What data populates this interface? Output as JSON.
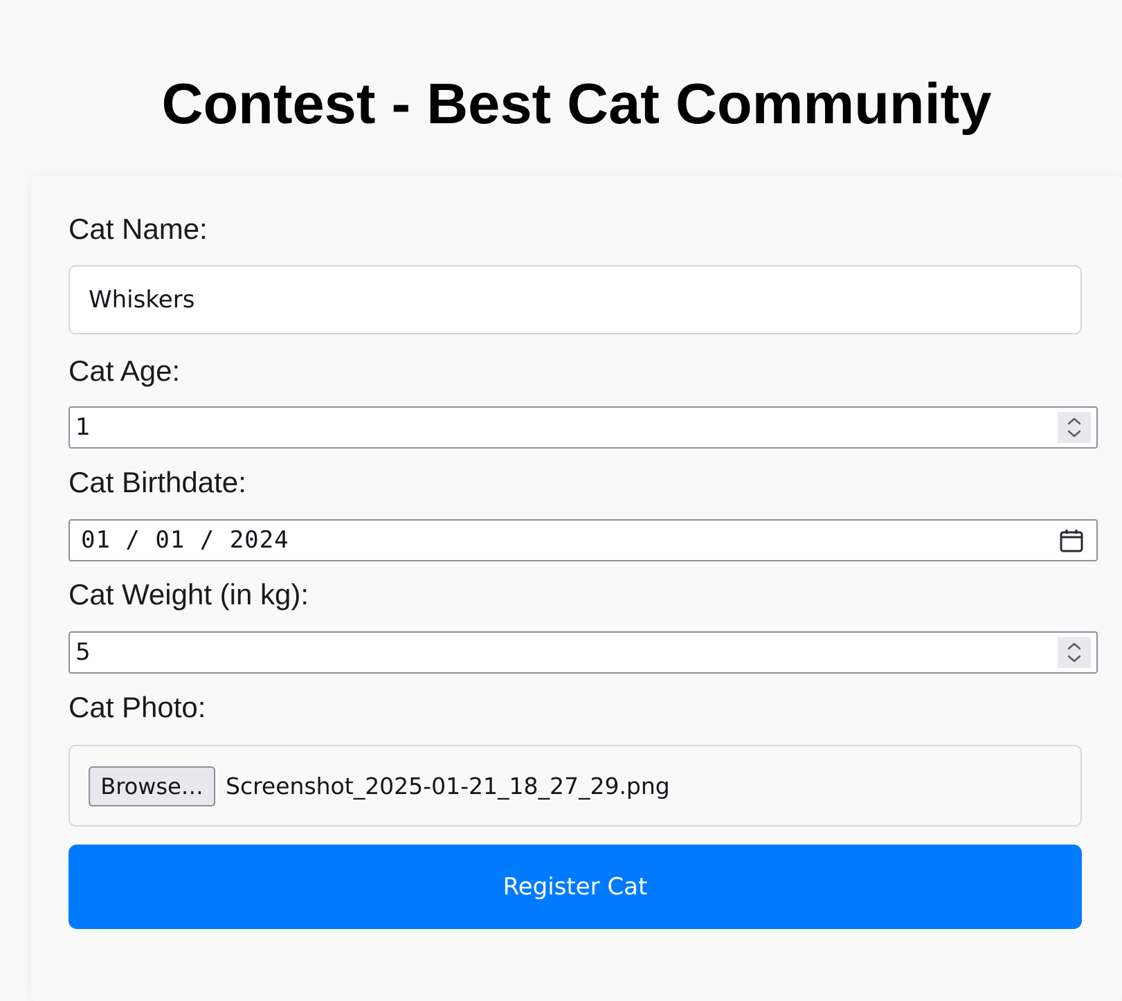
{
  "page": {
    "title": "Contest - Best Cat Community"
  },
  "form": {
    "name": {
      "label": "Cat Name:",
      "value": "Whiskers"
    },
    "age": {
      "label": "Cat Age:",
      "value": "1"
    },
    "birthdate": {
      "label": "Cat Birthdate:",
      "value": "01 / 01 / 2024"
    },
    "weight": {
      "label": "Cat Weight (in kg):",
      "value": "5"
    },
    "photo": {
      "label": "Cat Photo:",
      "browse_label": "Browse…",
      "file_name": "Screenshot_2025-01-21_18_27_29.png"
    },
    "submit_label": "Register Cat"
  },
  "colors": {
    "background": "#f9f9fa",
    "primary_button": "#007bff",
    "button_text": "#ffffff",
    "title_text": "#000000"
  },
  "icons": {
    "number_spinner": "up-down-chevron-icon",
    "date_picker": "calendar-icon"
  }
}
